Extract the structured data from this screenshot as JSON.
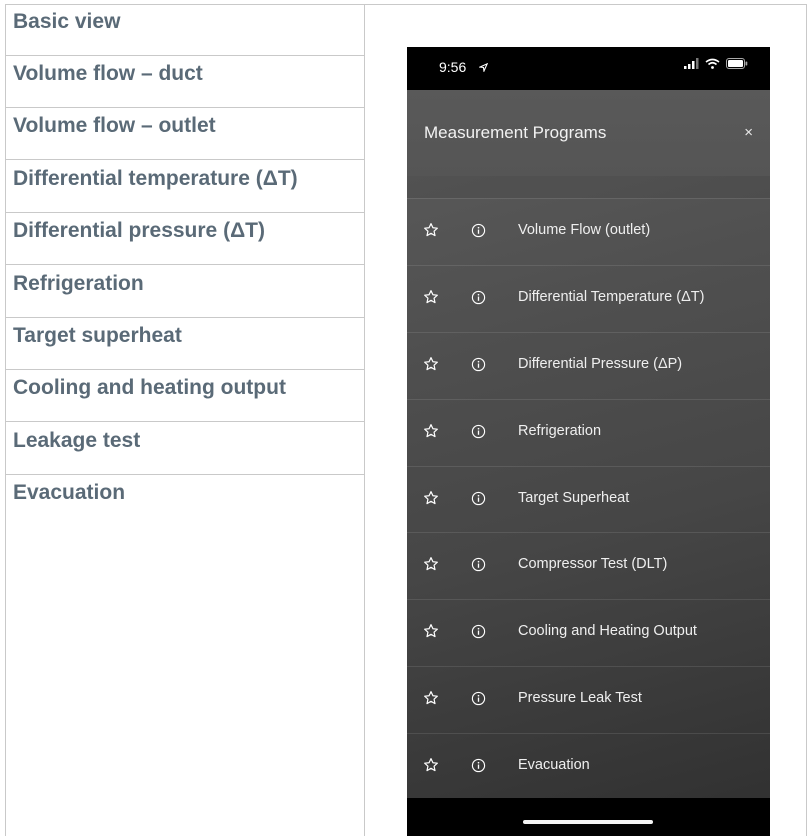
{
  "table": {
    "rows": [
      {
        "label": "Basic view"
      },
      {
        "label": "Volume flow – duct"
      },
      {
        "label": "Volume flow – outlet"
      },
      {
        "label": "Differential temperature (ΔT)"
      },
      {
        "label": "Differential pressure (ΔT)"
      },
      {
        "label": "Refrigeration"
      },
      {
        "label": "Target superheat"
      },
      {
        "label": "Cooling and heating output"
      },
      {
        "label": "Leakage test"
      },
      {
        "label": "Evacuation"
      }
    ]
  },
  "phone": {
    "status_bar": {
      "time": "9:56",
      "icons": [
        "location-arrow-icon",
        "signal-icon",
        "wifi-icon",
        "battery-icon"
      ]
    },
    "header": {
      "title": "Measurement Programs",
      "close_label": "×"
    },
    "programs": [
      {
        "label": "Volume Flow (outlet)"
      },
      {
        "label": "Differential Temperature (ΔT)"
      },
      {
        "label": "Differential Pressure (ΔP)"
      },
      {
        "label": "Refrigeration"
      },
      {
        "label": "Target Superheat"
      },
      {
        "label": "Compressor Test (DLT)"
      },
      {
        "label": "Cooling and Heating Output"
      },
      {
        "label": "Pressure Leak Test"
      },
      {
        "label": "Evacuation"
      }
    ]
  },
  "colors": {
    "table_text": "#5a6a77",
    "table_border": "#c9c9c9",
    "phone_text": "#efefef",
    "status_bar_bg": "#000000"
  }
}
